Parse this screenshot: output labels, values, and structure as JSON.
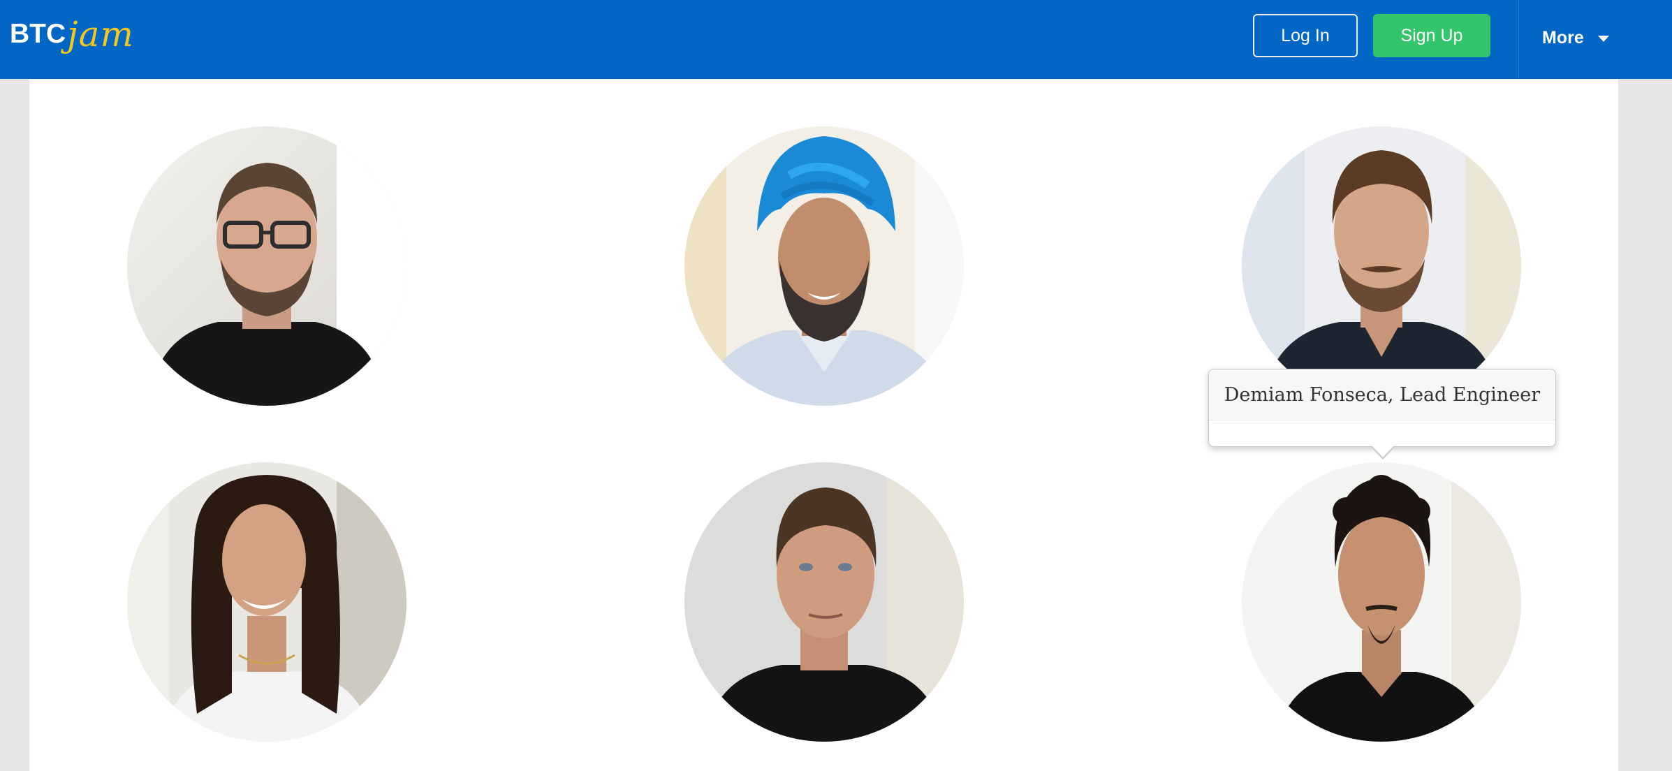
{
  "header": {
    "brand": {
      "part1": "BTC",
      "part2": "jam"
    },
    "login_label": "Log In",
    "signup_label": "Sign Up",
    "more_label": "More"
  },
  "team": {
    "members": [
      {
        "photo": "man-glasses-black-tshirt"
      },
      {
        "photo": "man-blue-turban-beard"
      },
      {
        "photo": "man-brown-hair-dark-shirt"
      },
      {
        "photo": "woman-long-curly-hair"
      },
      {
        "photo": "man-short-hair-black-tshirt"
      },
      {
        "photo": "man-curly-hair-goatee"
      }
    ],
    "tooltip": {
      "text": "Demiam Fonseca, Lead Engineer"
    }
  },
  "colors": {
    "header_bg": "#0166c4",
    "signup_bg": "#33c56b",
    "brand_accent": "#f2c71f",
    "page_bg": "#e6e6e6",
    "panel_bg": "#ffffff"
  }
}
